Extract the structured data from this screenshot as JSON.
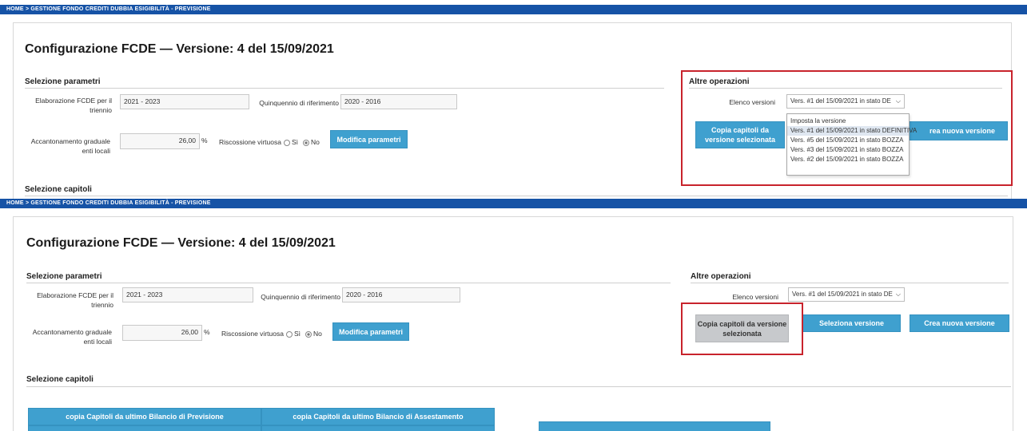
{
  "breadcrumb": "HOME  >  GESTIONE FONDO CREDITI DUBBIA ESIGIBILITÀ - PREVISIONE",
  "page_title": "Configurazione FCDE — Versione: 4 del 15/09/2021",
  "sections": {
    "parametri": "Selezione parametri",
    "altre": "Altre operazioni",
    "capitoli": "Selezione capitoli"
  },
  "fields": {
    "elaborazione_label": "Elaborazione FCDE per il triennio",
    "elaborazione_value": "2021 - 2023",
    "quinquennio_label": "Quinquennio di riferimento",
    "quinquennio_value": "2020 - 2016",
    "accantonamento_label": "Accantonamento graduale enti locali",
    "accantonamento_value": "26,00",
    "percent": "%",
    "riscossione_label": "Riscossione virtuosa",
    "si": "Sì",
    "no": "No"
  },
  "buttons": {
    "modifica": "Modifica parametri",
    "copia": "Copia capitoli da versione selezionata",
    "seleziona": "Seleziona versione",
    "crea": "Crea nuova versione",
    "crea_partial": "rea nuova versione",
    "copia_previsione": "copia Capitoli da ultimo Bilancio di Previsione",
    "copia_assestamento": "copia Capitoli da ultimo Bilancio di Assestamento"
  },
  "versions": {
    "label": "Elenco versioni",
    "selected": "Vers. #1 del 15/09/2021 in stato DE",
    "options": [
      "Imposta la versione",
      "Vers. #1 del 15/09/2021 in stato DEFINITIVA",
      "Vers. #5 del 15/09/2021 in stato BOZZA",
      "Vers. #3 del 15/09/2021 in stato BOZZA",
      "Vers. #2 del 15/09/2021 in stato BOZZA"
    ]
  },
  "colors": {
    "breadcrumb_bg": "#1653a6",
    "button_bg": "#3fa0cf",
    "highlight": "#c8232c"
  }
}
